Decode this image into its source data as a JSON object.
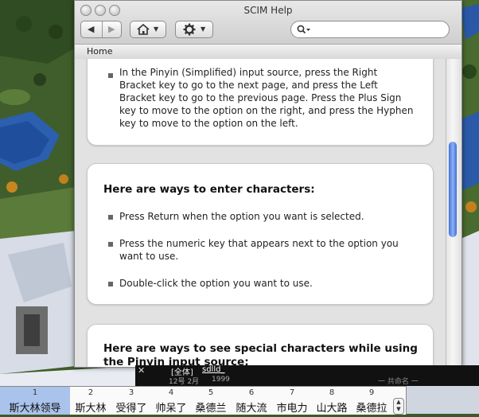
{
  "window": {
    "title": "SCIM Help",
    "breadcrumb": "Home",
    "search_placeholder": "",
    "home_icon": "house-icon",
    "action_icon": "gear-icon"
  },
  "content": {
    "card1": {
      "bullet_text": "In the Pinyin (Simplified) input source, press the Right Bracket key to go to the next page, and press the Left Bracket key to go to the previous page. Press the Plus Sign key to move to the option on the right, and press the Hyphen key to move to the option on the left."
    },
    "card2": {
      "heading": "Here are ways to enter characters:",
      "items": [
        "Press Return when the option you want is selected.",
        "Press the numeric key that appears next to the option you want to use.",
        "Double-click the option you want to use."
      ]
    },
    "card3": {
      "heading": "Here are ways to see special characters while using the Pinyin input source:"
    }
  },
  "ime": {
    "close": "✕",
    "mode": "[全体]",
    "composition": "sdlld_",
    "date": "12号 2月",
    "year": "1999",
    "right_label": "一 共命名 一"
  },
  "candidates": {
    "selected_index": 0,
    "items": [
      {
        "num": "1",
        "word": "斯大林领导"
      },
      {
        "num": "2",
        "word": "斯大林"
      },
      {
        "num": "3",
        "word": "受得了"
      },
      {
        "num": "4",
        "word": "帅呆了"
      },
      {
        "num": "5",
        "word": "桑德兰"
      },
      {
        "num": "6",
        "word": "随大流"
      },
      {
        "num": "7",
        "word": "市电力"
      },
      {
        "num": "8",
        "word": "山大路"
      },
      {
        "num": "9",
        "word": "桑德拉"
      }
    ]
  },
  "colors": {
    "selection": "#a9c3ec",
    "scroll_thumb": "#3f6fd6"
  }
}
